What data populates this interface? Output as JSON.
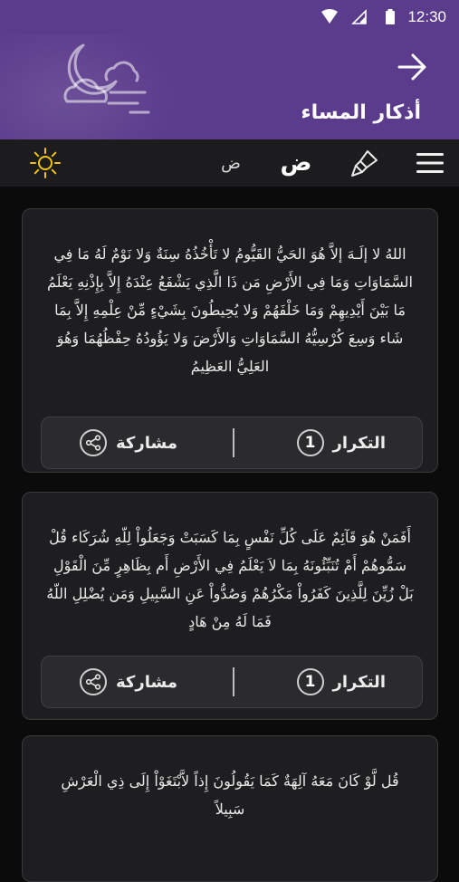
{
  "status": {
    "time": "12:30"
  },
  "header": {
    "title": "أذكار المساء",
    "back_icon": "arrow-right-icon",
    "art_icon": "moon-clouds-icon",
    "background": "#5b3b8c"
  },
  "toolbar": {
    "font_large": "ض",
    "font_small": "ض",
    "background": "#1c1c1e"
  },
  "cards": [
    {
      "text": "اللهُ لا إلَـهَ إلاَّ هُوَ الحَيُّ القَيُّومُ لا تَأْخُذُهُ سِنَةٌ وَلا نَوْمٌ لَهُ مَا فِي السَّمَاوَاتِ وَمَا فِي الأَرْضِ مَن ذَا الَّذِي يَشْفَعُ عِنْدَهُ إِلاَّ بِإِذْنِهِ يَعْلَمُ مَا بَيْنَ أَيْدِيهِمْ وَمَا خَلْفَهُمْ وَلا يُحِيطُونَ بِشَيْءٍ مِّنْ عِلْمِهِ إِلاَّ بِمَا شَاء وَسِعَ كُرْسِيُّهُ السَّمَاوَاتِ وَالأَرْضَ وَلا يَؤُودُهُ حِفْظُهُمَا وَهُوَ العَلِيُّ العَظِيمُ",
      "repeat_label": "التكرار",
      "repeat_count": "1",
      "share_label": "مشاركة"
    },
    {
      "text": "أَفَمَنْ هُوَ قَآئِمٌ عَلَى كُلِّ نَفْسٍ بِمَا كَسَبَتْ وَجَعَلُواْ لِلّهِ شُرَكَاء قُلْ سَمُّوهُمْ أَمْ تُنَبِّئُونَهُ بِمَا لاَ يَعْلَمُ فِي الأَرْضِ أَم بِظَاهِرٍ مِّنَ الْقَوْلِ بَلْ زُيِّنَ لِلَّذِينَ كَفَرُواْ مَكْرُهُمْ وَصُدُّواْ عَنِ السَّبِيلِ وَمَن يُضْلِلِ اللّهُ فَمَا لَهُ مِنْ هَادٍ",
      "repeat_label": "التكرار",
      "repeat_count": "1",
      "share_label": "مشاركة"
    },
    {
      "text": "قُل لَّوْ كَانَ مَعَهُ آلِهَةٌ كَمَا يَقُولُونَ إِذاً لاَّبْتَغَوْاْ إِلَى ذِي الْعَرْشِ سَبِيلاً"
    }
  ]
}
